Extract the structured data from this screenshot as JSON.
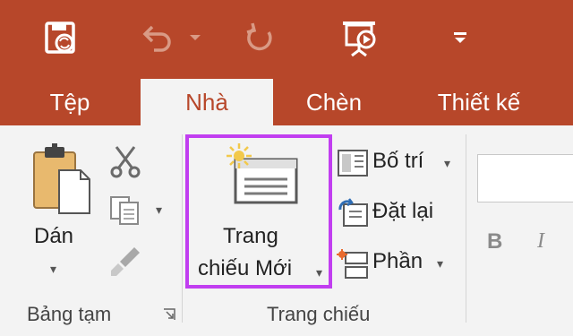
{
  "tabs": [
    {
      "label": "Tệp",
      "active": false
    },
    {
      "label": "Nhà",
      "active": true
    },
    {
      "label": "Chèn",
      "active": false
    },
    {
      "label": "Thiết kế",
      "active": false
    }
  ],
  "quick_access": {
    "save_icon": "save-sync-icon",
    "undo_icon": "undo-icon",
    "redo_icon": "redo-icon",
    "present_icon": "present-from-start-icon",
    "customize_icon": "customize-toolbar-icon"
  },
  "clipboard": {
    "paste_label": "Dán",
    "group_label": "Bảng tạm"
  },
  "slides": {
    "new_slide_line1": "Trang",
    "new_slide_line2": "chiếu Mới",
    "layout_label": "Bố trí",
    "reset_label": "Đặt lại",
    "section_label": "Phần",
    "group_label": "Trang chiếu"
  },
  "font": {
    "bold_label": "B",
    "italic_label": "I"
  },
  "colors": {
    "accent": "#b7472a",
    "highlight": "#c13ef0",
    "ribbon_bg": "#f3f3f3"
  }
}
